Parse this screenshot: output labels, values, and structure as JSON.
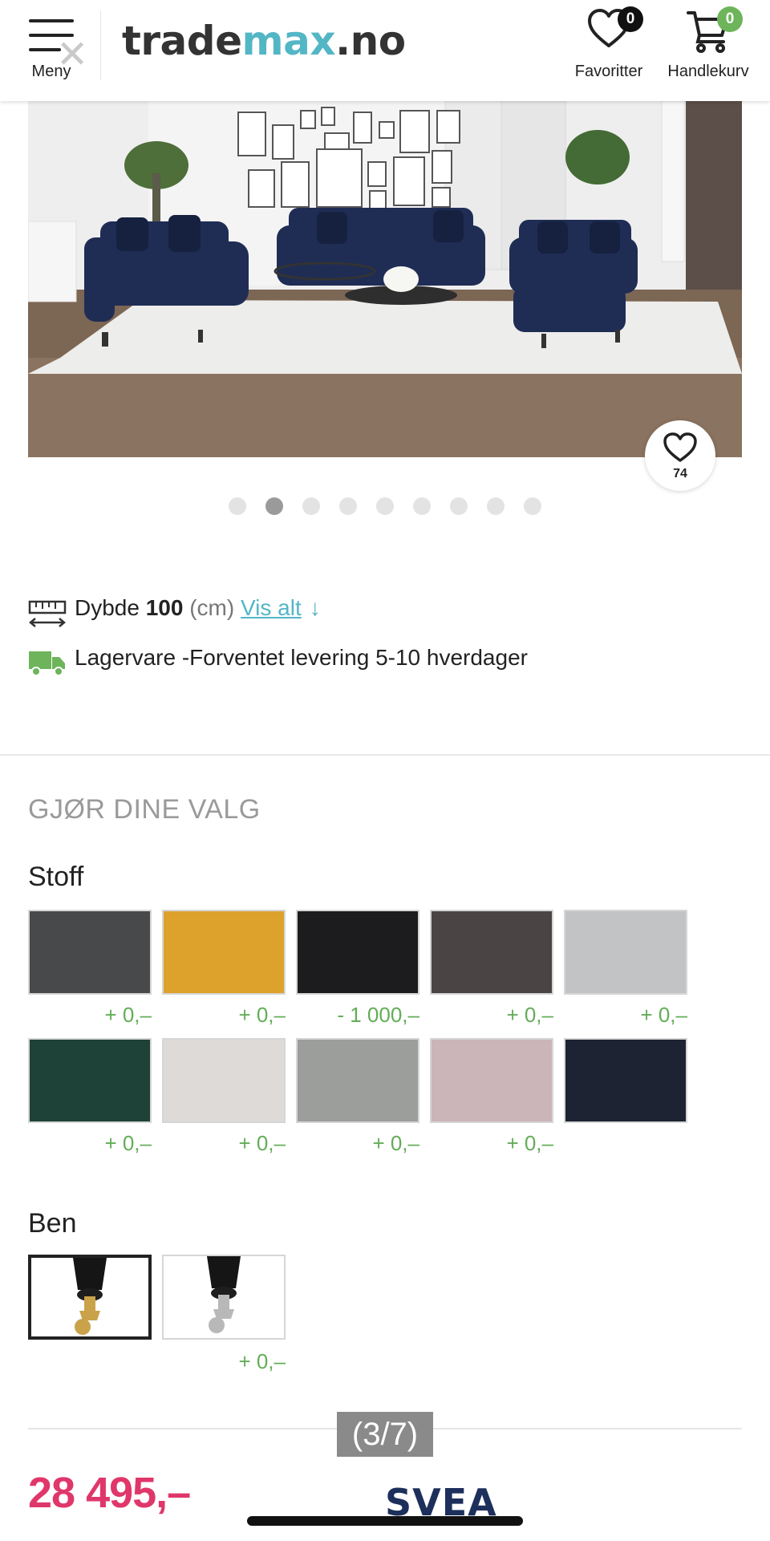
{
  "header": {
    "menu_label": "Meny",
    "logo_main": "trade",
    "logo_accent": "max",
    "logo_suffix": ".no",
    "favorites": {
      "label": "Favoritter",
      "count": "0"
    },
    "cart": {
      "label": "Handlekurv",
      "count": "0"
    }
  },
  "gallery": {
    "like_count": "74",
    "dots_total": 9,
    "dots_active_index": 1
  },
  "specs": {
    "depth_label": "Dybde",
    "depth_value": "100",
    "depth_unit": "(cm)",
    "show_all_link": "Vis alt",
    "show_all_arrow": "↓",
    "delivery_text": "Lagervare -Forventet levering 5-10 hverdager"
  },
  "options": {
    "section_title": "GJØR DINE VALG",
    "fabric": {
      "title": "Stoff",
      "swatches": [
        {
          "color": "#48494b",
          "price": "+ 0,–"
        },
        {
          "color": "#dda22c",
          "price": "+ 0,–"
        },
        {
          "color": "#1c1c1e",
          "price": "- 1 000,–"
        },
        {
          "color": "#4a4544",
          "price": "+ 0,–"
        },
        {
          "color": "#c2c3c5",
          "price": "+ 0,–"
        },
        {
          "color": "#1e4238",
          "price": "+ 0,–"
        },
        {
          "color": "#dedad7",
          "price": "+ 0,–"
        },
        {
          "color": "#9c9e9c",
          "price": "+ 0,–"
        },
        {
          "color": "#cbb5b9",
          "price": "+ 0,–"
        },
        {
          "color": "#1e2333",
          "price": ""
        }
      ]
    },
    "legs": {
      "title": "Ben",
      "items": [
        {
          "finish": "brass",
          "selected": true,
          "price": ""
        },
        {
          "finish": "chrome",
          "selected": false,
          "price": "+ 0,–"
        }
      ]
    }
  },
  "footer": {
    "price": "28 495,–",
    "payment_brand": "SVEA",
    "page_indicator": "(3/7)"
  },
  "colors": {
    "accent_teal": "#53b6c5",
    "price_pink": "#e0376b",
    "add_price_green": "#63ad57",
    "cart_badge_green": "#6db45a"
  }
}
